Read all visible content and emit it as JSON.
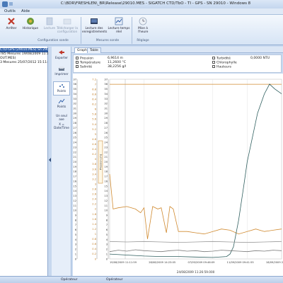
{
  "window": {
    "title": "C:\\BDR\\FRESHLEN\\_BR\\Release\\29010.MES - SIGATCH CTD/TbO - TI - GPS - SN 29010 - Windows 8"
  },
  "menu": [
    "Outils",
    "Aide"
  ],
  "ribbon": {
    "buttons": [
      {
        "label": "Arrêter",
        "icon": "stop-icon",
        "color": "#c0392b",
        "disabled": false
      },
      {
        "label": "Historique",
        "icon": "history-icon",
        "color": "#6a9a3a",
        "disabled": false
      },
      {
        "label": "Lecture",
        "icon": "read-icon",
        "color": "#9fb3cf",
        "disabled": true
      },
      {
        "label": "Télécharger la configuration",
        "icon": "download-config-icon",
        "color": "#b9c7da",
        "disabled": true
      },
      {
        "label": "Lecture des enregistrements",
        "icon": "records-icon",
        "color": "#2f4060",
        "disabled": false
      },
      {
        "label": "Lecture temps réel",
        "icon": "realtime-icon",
        "color": "#5d7fb0",
        "disabled": false
      },
      {
        "label": "Mise à l'heure",
        "icon": "clock-icon",
        "color": "#9aa9be",
        "disabled": false
      }
    ],
    "groups": [
      "Configuration sonde",
      "Mesures sonde",
      "Réglage"
    ]
  },
  "tree": {
    "items": [
      {
        "text": "CTD-GPS (29010.MES) Sn 29010",
        "selected": true
      },
      {
        "text": "785 Mesures 19/08/2009 11:11:5",
        "selected": false
      },
      {
        "text": "OUT.MES)",
        "selected": false
      },
      {
        "text": "3 Mesures 25/07/2012 15:11:21",
        "selected": false
      }
    ]
  },
  "tools": [
    {
      "label": "Exporter",
      "icon": "export-icon",
      "selected": false
    },
    {
      "label": "Imprimer",
      "icon": "print-icon",
      "selected": false
    },
    {
      "label": "Points",
      "icon": "points-icon",
      "selected": true
    },
    {
      "label": "Points",
      "icon": "line-points-icon",
      "selected": false
    },
    {
      "label": "Un seul axe",
      "icon": "",
      "selected": false
    },
    {
      "label": "X = Date/Time",
      "icon": "",
      "selected": false
    }
  ],
  "tabs": [
    {
      "label": "Graph",
      "active": true
    },
    {
      "label": "Table",
      "active": false
    }
  ],
  "info": {
    "left": [
      {
        "label": "Pression",
        "value": "6,9614 m",
        "checked": true
      },
      {
        "label": "Température",
        "value": "11,2600 °C",
        "checked": true
      },
      {
        "label": "Salinité",
        "value": "38,2256 g/l",
        "checked": true
      }
    ],
    "right": [
      {
        "label": "Turbidité",
        "value": "0,0000 NTU",
        "checked": true
      },
      {
        "label": "Chlorophylle",
        "value": "",
        "checked": false
      },
      {
        "label": "Hauteurs",
        "value": "",
        "checked": false
      }
    ]
  },
  "chart_data": {
    "type": "line",
    "x_ticks": [
      "19/08/2009 11:11:59",
      "28/08/2009 14:23:05",
      "07/09/2009 09:46:09",
      "11/09/2009 09:41:55",
      "18/09/2009 22:11:56"
    ],
    "x_center_label": "24/08/2009 11:26:59.000",
    "vertical_axis_label": "Pression (m)",
    "axes": [
      {
        "ticks": [
          "0",
          "1",
          "2",
          "3",
          "4",
          "5",
          "6",
          "7",
          "8",
          "9",
          "10",
          "11",
          "12",
          "13",
          "14",
          "15",
          "16",
          "17",
          "18",
          "19",
          "20",
          "21",
          "22",
          "23",
          "24",
          "25",
          "26",
          "27",
          "28",
          "29",
          "30",
          "31",
          "32",
          "33",
          "34",
          "35",
          "36",
          "37"
        ],
        "color": "#333333",
        "ylim": [
          0,
          37
        ]
      },
      {
        "ticks": [
          "0",
          "0.2",
          "0.4",
          "0.6",
          "0.8",
          "1",
          "1.2",
          "1.4",
          "1.6",
          "1.8",
          "2",
          "2.2",
          "2.4",
          "2.6",
          "2.8",
          "3",
          "3.2",
          "3.4",
          "3.6",
          "3.8",
          "4",
          "4.2",
          "4.4",
          "4.6",
          "4.8",
          "5",
          "5.2",
          "5.4",
          "5.6",
          "5.8",
          "6",
          "6.2",
          "6.4",
          "6.6",
          "6.8",
          "7",
          "7.2"
        ],
        "color": "#c07a20",
        "ylim": [
          0,
          7.2
        ]
      },
      {
        "ticks": [
          "0",
          "1",
          "2",
          "3",
          "4",
          "5",
          "6",
          "7",
          "8",
          "9",
          "10",
          "11",
          "12",
          "13",
          "14",
          "15",
          "16",
          "17",
          "18",
          "19",
          "20",
          "21",
          "22",
          "23",
          "24",
          "25",
          "26",
          "27",
          "28",
          "29",
          "30",
          "31",
          "32",
          "33",
          "34",
          "35",
          "36",
          "37"
        ],
        "color": "#333333",
        "ylim": [
          0,
          37
        ]
      }
    ],
    "series": [
      {
        "color": "#d08a30",
        "axis": 1,
        "x": [
          0,
          0.02,
          0.05,
          0.1,
          0.15,
          0.18,
          0.2,
          0.22,
          0.25,
          0.28,
          0.3,
          0.33,
          0.35,
          0.37,
          0.4,
          0.45,
          0.5,
          0.55,
          0.6,
          0.65,
          0.7,
          0.75,
          0.8,
          0.85,
          0.9,
          0.95,
          1.0
        ],
        "y": [
          3.4,
          2.0,
          2.05,
          2.1,
          2.0,
          1.85,
          2.05,
          0.8,
          2.1,
          2.0,
          2.05,
          1.05,
          2.1,
          2.0,
          1.1,
          1.1,
          1.05,
          1.0,
          1.1,
          1.2,
          1.15,
          1.0,
          1.1,
          1.2,
          1.1,
          1.15,
          1.2
        ]
      },
      {
        "color": "#d08a30",
        "axis": 1,
        "x": [
          0,
          1.0
        ],
        "y": [
          7.0,
          7.0
        ]
      },
      {
        "color": "#2f5f5f",
        "axis": 2,
        "x": [
          0,
          0.1,
          0.2,
          0.3,
          0.4,
          0.5,
          0.6,
          0.68,
          0.7,
          0.72,
          0.75,
          0.78,
          0.8,
          0.83,
          0.86,
          0.9,
          0.93,
          0.96,
          1.0
        ],
        "y": [
          1.0,
          0.8,
          0.6,
          0.5,
          0.5,
          0.4,
          0.3,
          0.5,
          1.0,
          2.5,
          8,
          15,
          20,
          25,
          30,
          34,
          36,
          35,
          34
        ]
      },
      {
        "color": "#7a7a7a",
        "axis": 0,
        "x": [
          0,
          0.05,
          0.1,
          0.15,
          0.2,
          0.25,
          0.3,
          0.35,
          0.4,
          0.45,
          0.5,
          0.55,
          0.6,
          0.65,
          0.7,
          0.75,
          0.8,
          0.85,
          0.9,
          0.95,
          1.0
        ],
        "y": [
          1.5,
          1.8,
          1.6,
          1.9,
          1.7,
          1.6,
          1.5,
          1.7,
          1.8,
          1.6,
          1.7,
          1.5,
          1.6,
          1.8,
          1.7,
          1.6,
          1.5,
          1.7,
          1.6,
          1.8,
          1.7
        ]
      },
      {
        "color": "#9a9a9a",
        "axis": 0,
        "x": [
          0,
          0.1,
          0.2,
          0.3,
          0.4,
          0.5,
          0.6,
          0.7,
          0.8,
          0.9,
          1.0
        ],
        "y": [
          3.6,
          3.5,
          3.6,
          3.5,
          3.4,
          3.5,
          3.6,
          3.5,
          3.4,
          3.5,
          3.6
        ]
      }
    ],
    "grid": true
  },
  "status": [
    "Opérateur",
    "Opérateur"
  ]
}
